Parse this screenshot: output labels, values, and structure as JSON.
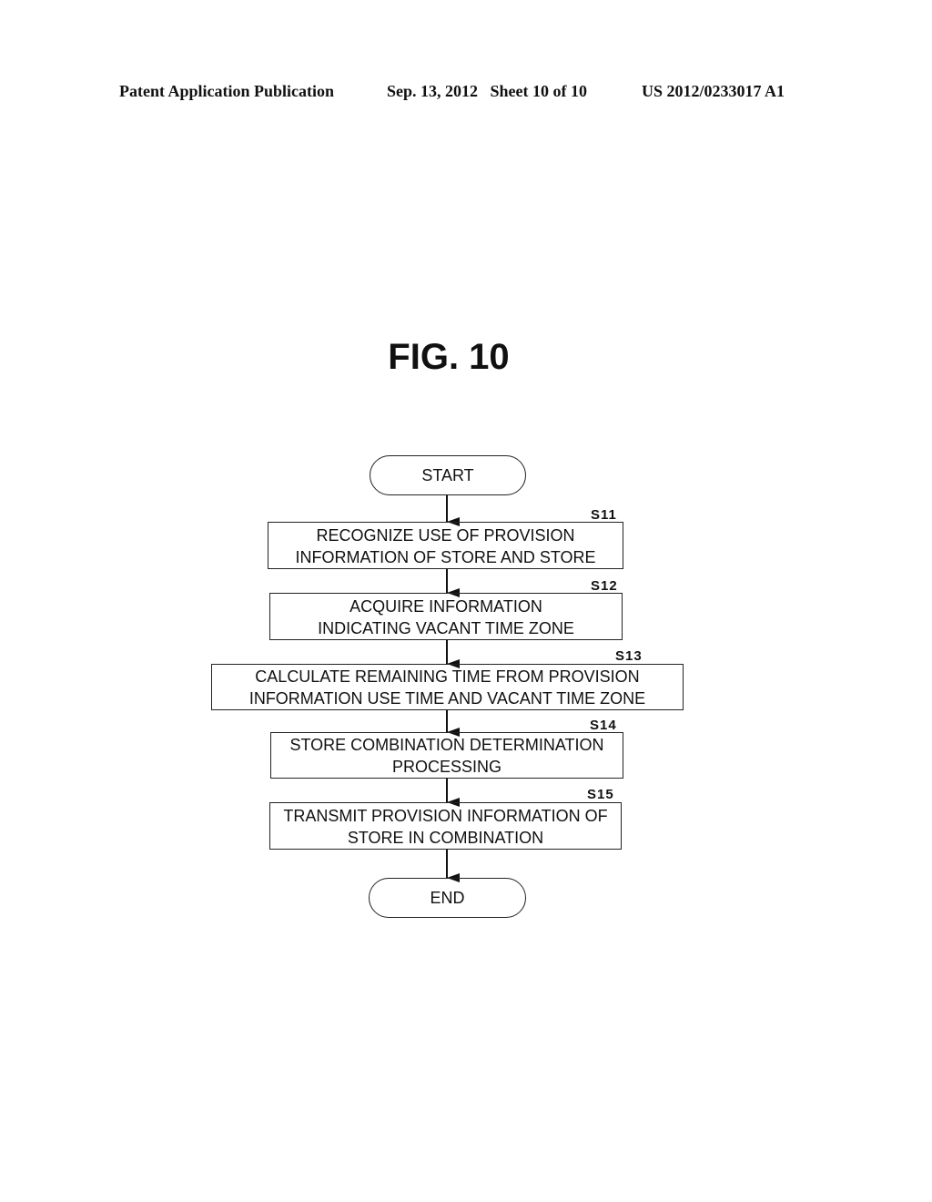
{
  "header": {
    "left": "Patent Application Publication",
    "middle": "Sep. 13, 2012   Sheet 10 of 10",
    "right": "US 2012/0233017 A1"
  },
  "figure": {
    "title": "FIG. 10"
  },
  "flowchart": {
    "start": "START",
    "end": "END",
    "steps": [
      {
        "id": "S11",
        "lines": [
          "RECOGNIZE USE OF PROVISION",
          "INFORMATION OF STORE AND STORE"
        ]
      },
      {
        "id": "S12",
        "lines": [
          "ACQUIRE INFORMATION",
          "INDICATING VACANT TIME ZONE"
        ]
      },
      {
        "id": "S13",
        "lines": [
          "CALCULATE REMAINING TIME FROM PROVISION",
          "INFORMATION USE TIME AND VACANT TIME ZONE"
        ]
      },
      {
        "id": "S14",
        "lines": [
          "STORE COMBINATION DETERMINATION",
          "PROCESSING"
        ]
      },
      {
        "id": "S15",
        "lines": [
          "TRANSMIT PROVISION INFORMATION OF",
          "STORE IN COMBINATION"
        ]
      }
    ]
  }
}
